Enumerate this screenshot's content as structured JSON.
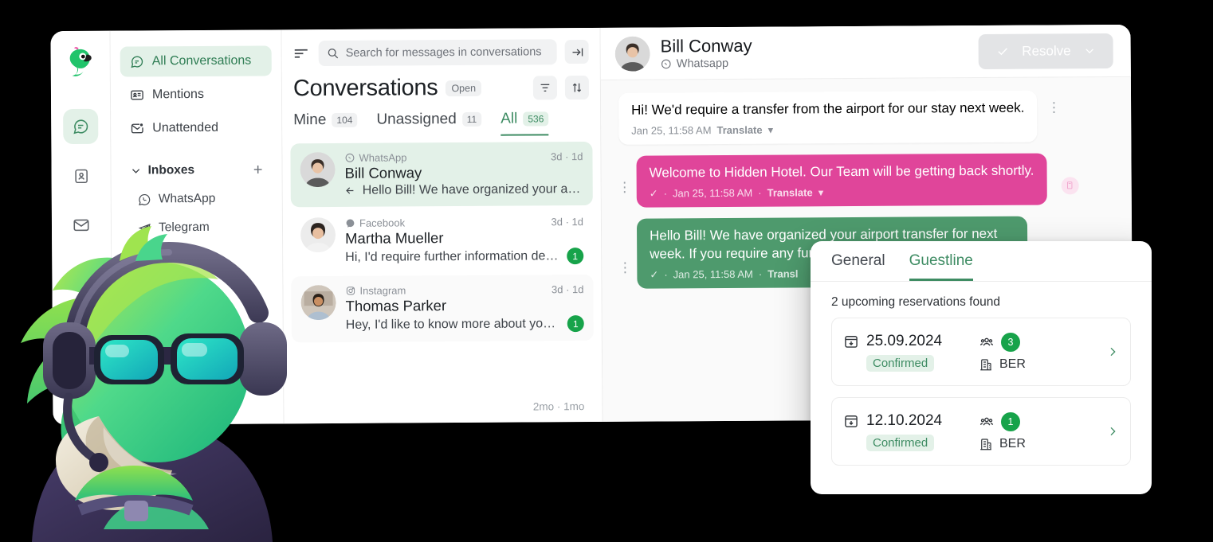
{
  "rail": {
    "logo": "parrot-logo",
    "items": [
      {
        "icon": "chat-bubble-icon",
        "name": "conversations",
        "active": true
      },
      {
        "icon": "contact-card-icon",
        "name": "contacts",
        "active": false
      },
      {
        "icon": "envelope-icon",
        "name": "mail",
        "active": false
      }
    ]
  },
  "sidebar": {
    "nav": [
      {
        "label": "All Conversations",
        "icon": "chat-bubble-icon",
        "active": true
      },
      {
        "label": "Mentions",
        "icon": "mention-card-icon",
        "active": false
      },
      {
        "label": "Unattended",
        "icon": "envelope-dot-icon",
        "active": false
      }
    ],
    "group": {
      "label": "Inboxes",
      "add": "+",
      "chevron": "chevron-down-icon"
    },
    "channels": [
      {
        "label": "WhatsApp",
        "icon": "whatsapp-icon"
      },
      {
        "label": "Telegram",
        "icon": "telegram-icon"
      }
    ]
  },
  "list": {
    "search": {
      "placeholder": "Search for messages in conversations",
      "icon": "search-icon"
    },
    "title": "Conversations",
    "status_chip": "Open",
    "tabs": [
      {
        "label": "Mine",
        "count": "104",
        "active": false
      },
      {
        "label": "Unassigned",
        "count": "11",
        "active": false
      },
      {
        "label": "All",
        "count": "536",
        "active": true
      }
    ],
    "items": [
      {
        "channel": "WhatsApp",
        "channel_icon": "whatsapp-icon",
        "ago": "3d · 1d",
        "name": "Bill Conway",
        "snippet": "Hello Bill! We have organized your airport...",
        "reply_icon": "reply-arrow-icon",
        "badge": "",
        "selected": true
      },
      {
        "channel": "Facebook",
        "channel_icon": "messenger-icon",
        "ago": "3d · 1d",
        "name": "Martha Mueller",
        "snippet": "Hi, I'd require further information depen...",
        "reply_icon": "",
        "badge": "1",
        "selected": false
      },
      {
        "channel": "Instagram",
        "channel_icon": "instagram-icon",
        "ago": "3d · 1d",
        "name": "Thomas Parker",
        "snippet": "Hey, I'd like to know more about your off...",
        "reply_icon": "",
        "badge": "1",
        "selected": false
      }
    ],
    "footer_ago": "2mo · 1mo"
  },
  "chat": {
    "contact_name": "Bill Conway",
    "channel": "Whatsapp",
    "channel_icon": "whatsapp-icon",
    "resolve": {
      "label": "Resolve",
      "check": "check-icon",
      "chevron": "chevron-down-icon"
    },
    "collapse_chevron": "chevron-left-icon",
    "messages": [
      {
        "direction": "in",
        "text": "Hi! We'd require a transfer from the airport for our stay next week.",
        "time": "Jan 25, 11:58 AM",
        "translate": "Translate",
        "check": ""
      },
      {
        "direction": "out-pink",
        "text": "Welcome to Hidden Hotel. Our Team will be getting back shortly.",
        "time": "Jan 25, 11:58 AM",
        "translate": "Translate",
        "check": "✓"
      },
      {
        "direction": "out-green",
        "text": "Hello Bill! We have organized your airport transfer for next week. If you require any furth",
        "time": "Jan 25, 11:58 AM",
        "translate": "Transl",
        "check": "✓"
      }
    ]
  },
  "panel": {
    "tabs": [
      {
        "label": "General",
        "active": false
      },
      {
        "label": "Guestline",
        "active": true
      }
    ],
    "summary": "2 upcoming reservations found",
    "reservations": [
      {
        "date": "25.09.2024",
        "date_icon": "calendar-check-icon",
        "status": "Confirmed",
        "guests_icon": "guests-icon",
        "guests": "3",
        "property_icon": "building-icon",
        "property": "BER",
        "chevron": "chevron-right-icon"
      },
      {
        "date": "12.10.2024",
        "date_icon": "calendar-check-icon",
        "status": "Confirmed",
        "guests_icon": "guests-icon",
        "guests": "1",
        "property_icon": "building-icon",
        "property": "BER",
        "chevron": "chevron-right-icon"
      }
    ]
  },
  "colors": {
    "accent_green": "#3E8C63",
    "badge_green": "#17a34a",
    "bubble_pink": "#E0459A",
    "bubble_green": "#4E9A6D",
    "light_green": "#E3F1E8"
  }
}
